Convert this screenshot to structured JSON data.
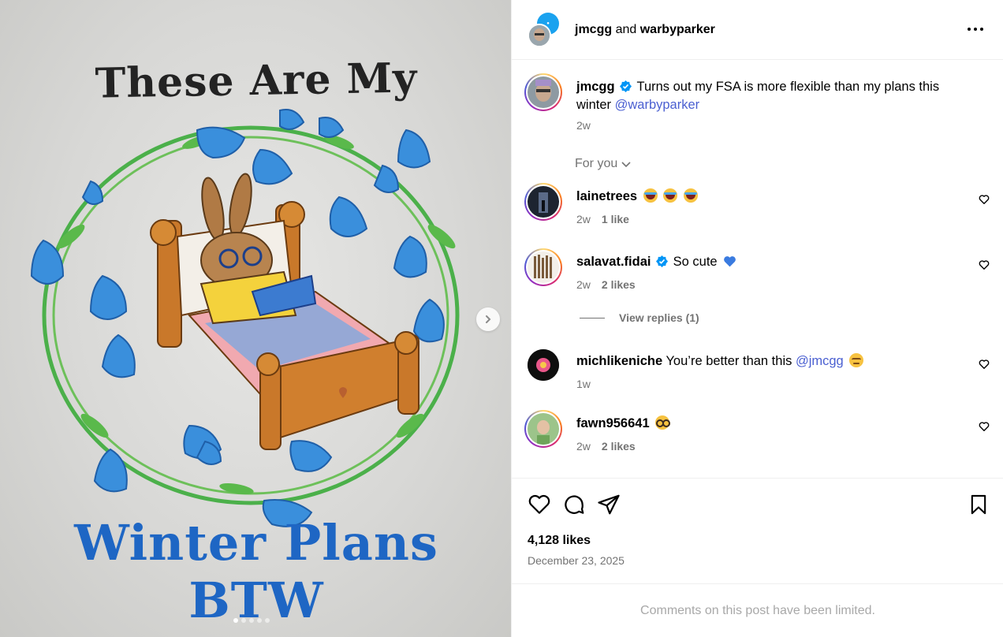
{
  "media": {
    "shirt_title": "These Are My",
    "shirt_subtitle": "Winter Plans BTW",
    "carousel": {
      "count": 5,
      "active_index": 0
    }
  },
  "header": {
    "user1": "jmcgg",
    "and": "and",
    "user2": "warbyparker"
  },
  "caption": {
    "username": "jmcgg",
    "text": "Turns out my FSA is more flexible than my plans this winter",
    "mention": "@warbyparker",
    "time": "2w"
  },
  "for_you": "For you",
  "comments": [
    {
      "username": "lainetrees",
      "text": "",
      "emoji": "laugh laugh laugh",
      "time": "2w",
      "likes": "1 like"
    },
    {
      "username": "salavat.fidai",
      "text": "So cute",
      "emoji": "blue-heart",
      "time": "2w",
      "likes": "2 likes"
    },
    {
      "username": "michlikeniche",
      "text": "You’re better than this",
      "mention": "@jmcgg",
      "emoji": "pensive",
      "time": "1w",
      "likes": ""
    },
    {
      "username": "fawn956641",
      "text": "",
      "emoji": "nerd",
      "time": "2w",
      "likes": "2 likes"
    }
  ],
  "view_replies": "View replies (1)",
  "likes_count": "4,128 likes",
  "post_date": "December 23, 2025",
  "comments_limited": "Comments on this post have been limited.",
  "colors": {
    "mention": "#4a5fd1",
    "verified": "#0095f6",
    "muted": "#737373",
    "blue_heart": "#3a7be0"
  }
}
